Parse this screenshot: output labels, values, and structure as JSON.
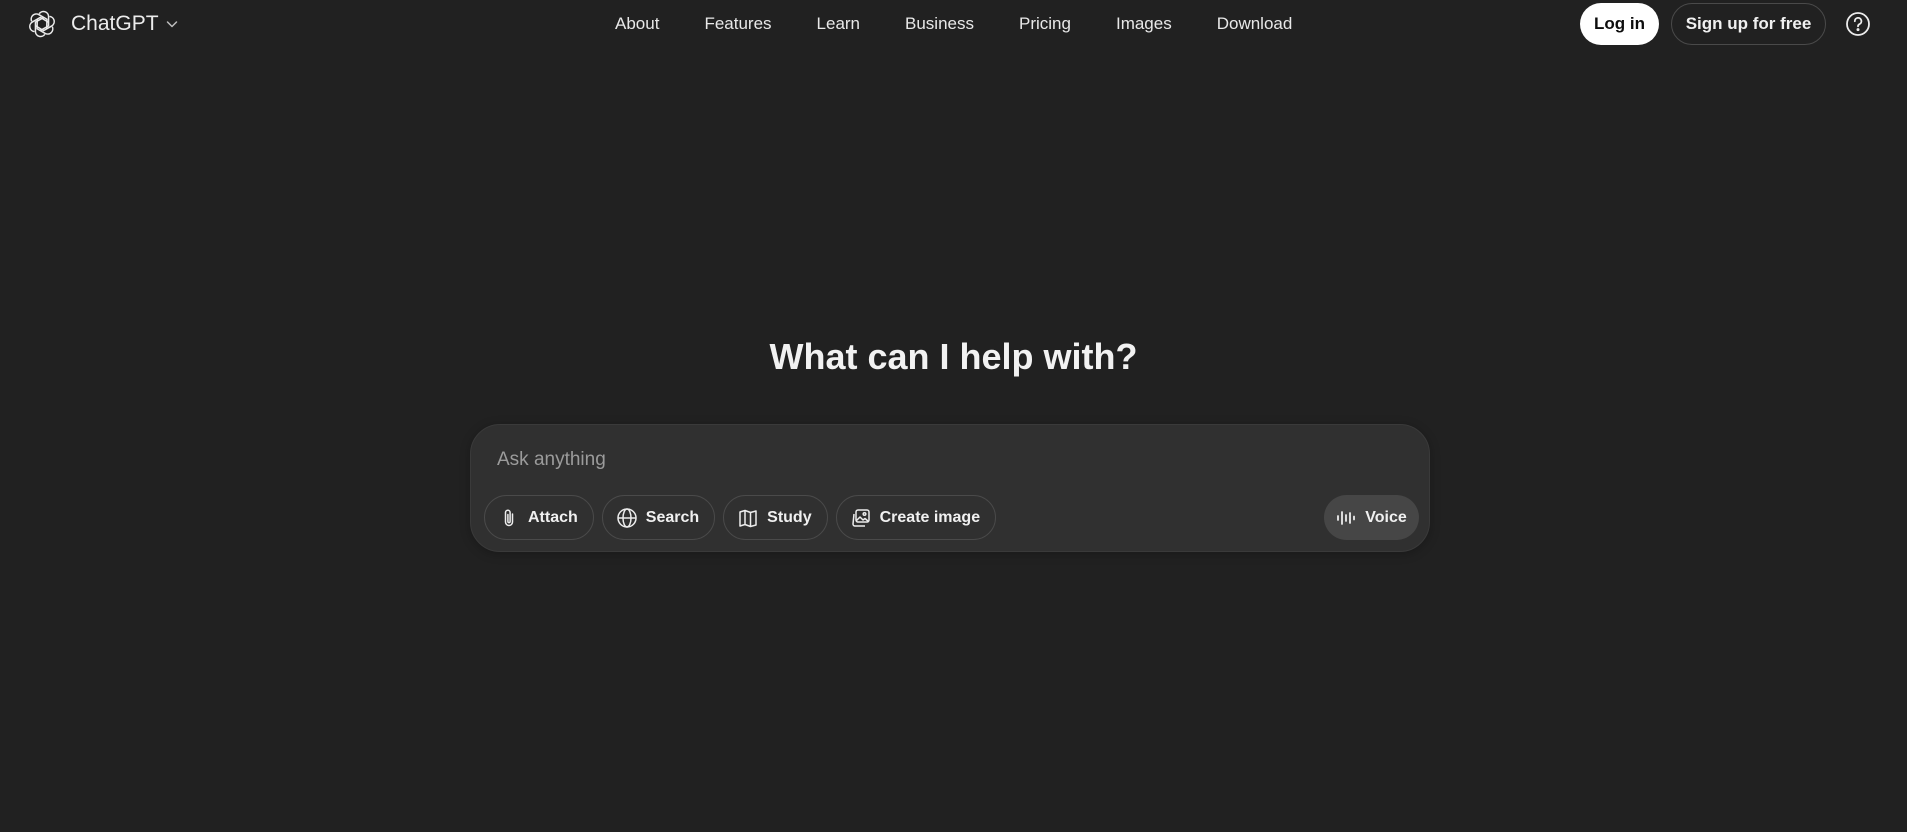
{
  "header": {
    "brand": {
      "name": "ChatGPT",
      "logo_icon": "openai-logo-icon",
      "menu_icon": "chevron-down-icon"
    },
    "nav": [
      {
        "label": "About"
      },
      {
        "label": "Features"
      },
      {
        "label": "Learn"
      },
      {
        "label": "Business"
      },
      {
        "label": "Pricing"
      },
      {
        "label": "Images"
      },
      {
        "label": "Download"
      }
    ],
    "login_label": "Log in",
    "signup_label": "Sign up for free",
    "help_icon": "help-circle-icon"
  },
  "main": {
    "headline": "What can I help with?",
    "composer": {
      "placeholder": "Ask anything",
      "value": "",
      "tools": [
        {
          "label": "Attach",
          "icon": "paperclip-icon"
        },
        {
          "label": "Search",
          "icon": "globe-icon"
        },
        {
          "label": "Study",
          "icon": "book-icon"
        },
        {
          "label": "Create image",
          "icon": "image-icon"
        }
      ],
      "voice": {
        "label": "Voice",
        "icon": "voice-waveform-icon"
      }
    }
  },
  "colors": {
    "background": "#212121",
    "composer_background": "#303030",
    "login_button": "#ffffff",
    "voice_button": "#464646",
    "text": "#ececec"
  }
}
